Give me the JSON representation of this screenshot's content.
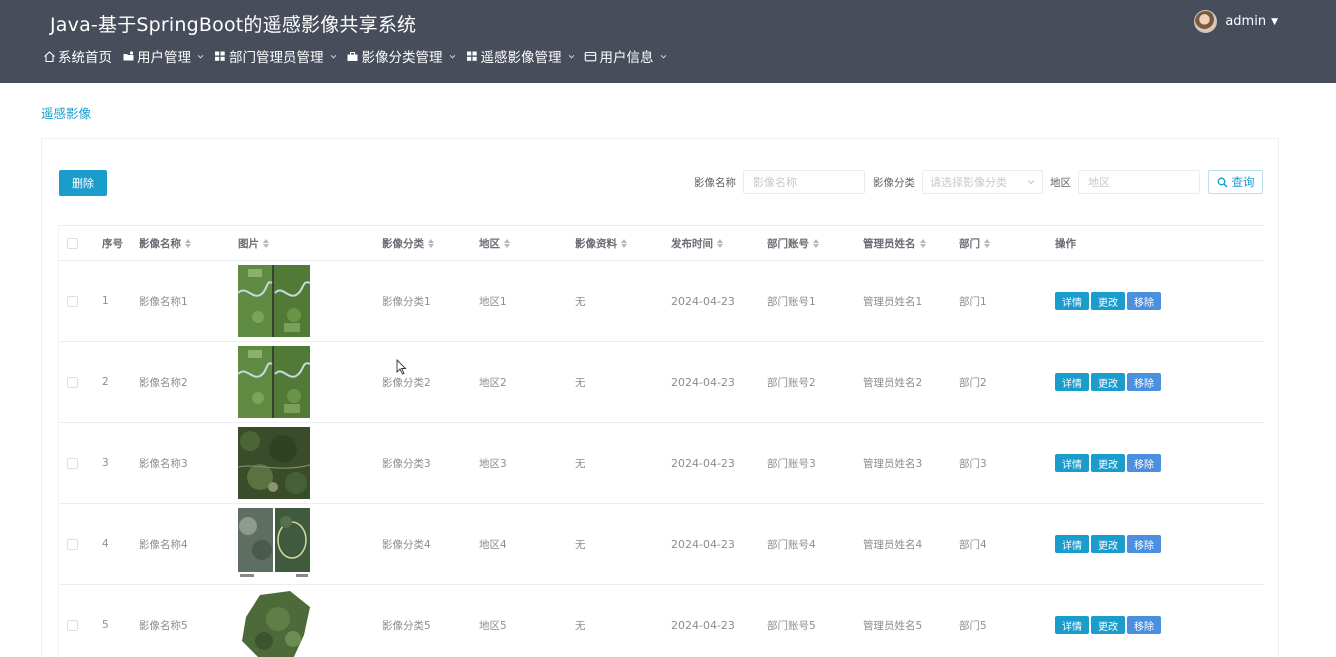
{
  "header": {
    "title": "Java-基于SpringBoot的遥感影像共享系统",
    "username": "admin"
  },
  "nav": [
    {
      "label": "系统首页",
      "icon": "home-icon",
      "dropdown": false
    },
    {
      "label": "用户管理",
      "icon": "user-folder-icon",
      "dropdown": true
    },
    {
      "label": "部门管理员管理",
      "icon": "grid-icon",
      "dropdown": true
    },
    {
      "label": "影像分类管理",
      "icon": "briefcase-icon",
      "dropdown": true
    },
    {
      "label": "遥感影像管理",
      "icon": "grid-icon",
      "dropdown": true
    },
    {
      "label": "用户信息",
      "icon": "id-card-icon",
      "dropdown": true
    }
  ],
  "breadcrumb": "遥感影像",
  "toolbar": {
    "delete_label": "删除",
    "name_label": "影像名称",
    "name_placeholder": "影像名称",
    "category_label": "影像分类",
    "category_placeholder": "请选择影像分类",
    "region_label": "地区",
    "region_placeholder": "地区",
    "query_label": "查询"
  },
  "table": {
    "columns": [
      "序号",
      "影像名称",
      "图片",
      "影像分类",
      "地区",
      "影像资料",
      "发布时间",
      "部门账号",
      "管理员姓名",
      "部门",
      "操作"
    ],
    "action_labels": {
      "detail": "详情",
      "edit": "更改",
      "remove": "移除"
    },
    "rows": [
      {
        "index": "1",
        "name": "影像名称1",
        "image": "aerial-river-image",
        "category": "影像分类1",
        "region": "地区1",
        "material": "无",
        "date": "2024-04-23",
        "dept_account": "部门账号1",
        "admin_name": "管理员姓名1",
        "dept": "部门1"
      },
      {
        "index": "2",
        "name": "影像名称2",
        "image": "aerial-river-image",
        "category": "影像分类2",
        "region": "地区2",
        "material": "无",
        "date": "2024-04-23",
        "dept_account": "部门账号2",
        "admin_name": "管理员姓名2",
        "dept": "部门2"
      },
      {
        "index": "3",
        "name": "影像名称3",
        "image": "aerial-forest-image",
        "category": "影像分类3",
        "region": "地区3",
        "material": "无",
        "date": "2024-04-23",
        "dept_account": "部门账号3",
        "admin_name": "管理员姓名3",
        "dept": "部门3"
      },
      {
        "index": "4",
        "name": "影像名称4",
        "image": "satellite-comparison-image",
        "category": "影像分类4",
        "region": "地区4",
        "material": "无",
        "date": "2024-04-23",
        "dept_account": "部门账号4",
        "admin_name": "管理员姓名4",
        "dept": "部门4"
      },
      {
        "index": "5",
        "name": "影像名称5",
        "image": "terrain-patch-image",
        "category": "影像分类5",
        "region": "地区5",
        "material": "无",
        "date": "2024-04-23",
        "dept_account": "部门账号5",
        "admin_name": "管理员姓名5",
        "dept": "部门5"
      }
    ]
  },
  "colors": {
    "header_bg": "#474d5a",
    "accent": "#1a9ccc",
    "remove_button": "#4a8fe0"
  }
}
